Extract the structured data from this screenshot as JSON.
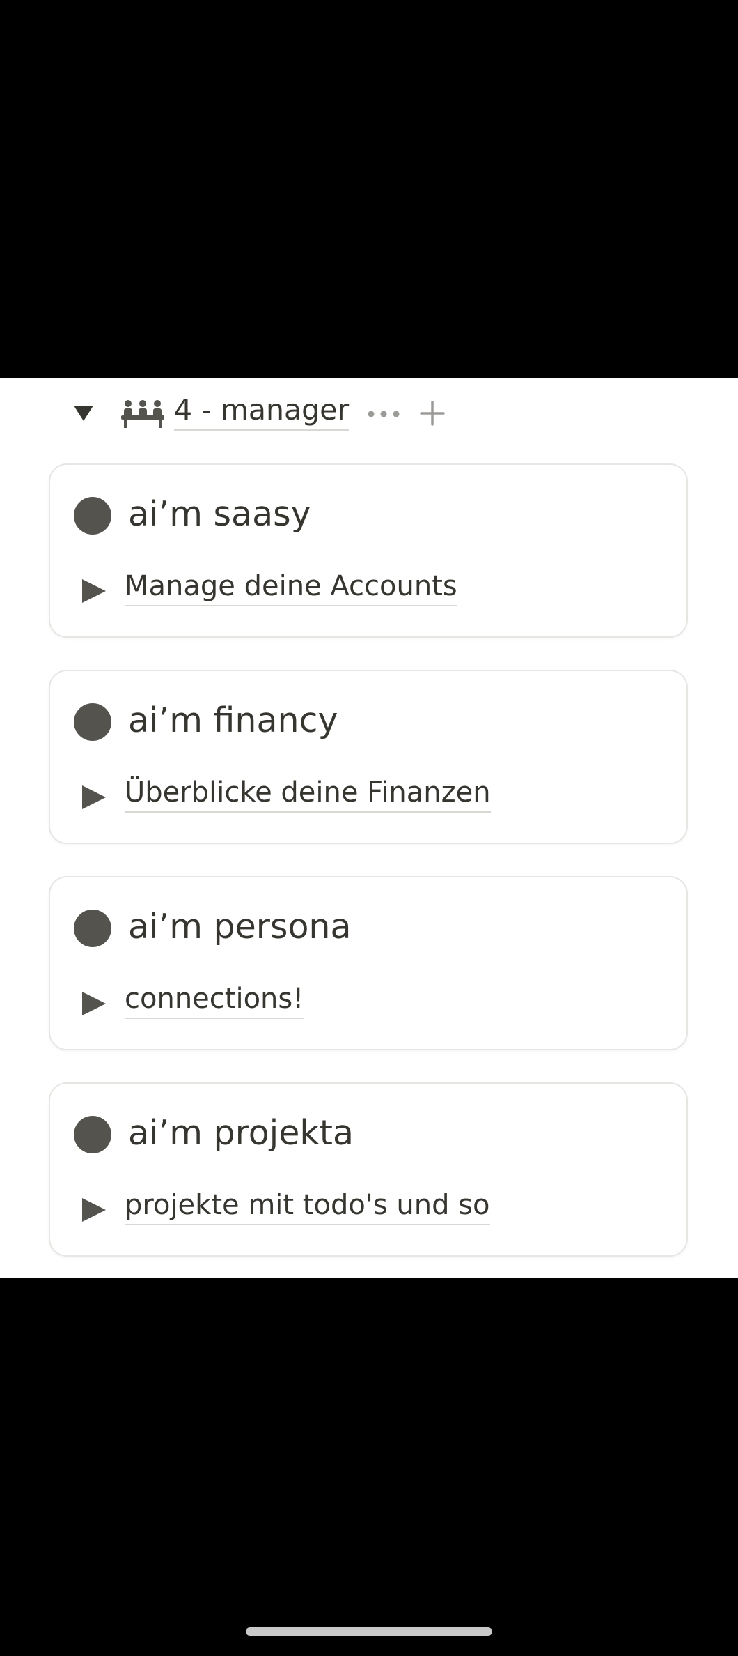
{
  "group": {
    "title": "4 - manager",
    "icons": {
      "toggle": "triangle-down-icon",
      "group": "team-icon",
      "more": "more-horizontal-icon",
      "add": "plus-icon"
    }
  },
  "cards": [
    {
      "title": "ai’m saasy",
      "link": "Manage deine Accounts"
    },
    {
      "title": "ai’m financy",
      "link": "Überblicke deine Finanzen"
    },
    {
      "title": "ai’m persona",
      "link": "connections!"
    },
    {
      "title": "ai’m projekta",
      "link": "projekte mit todo's und so"
    }
  ],
  "colors": {
    "text": "#37352f",
    "dot": "#55534e",
    "card_border": "#e7e6e3",
    "icon_gray": "#9b9a97",
    "background": "#ffffff"
  }
}
